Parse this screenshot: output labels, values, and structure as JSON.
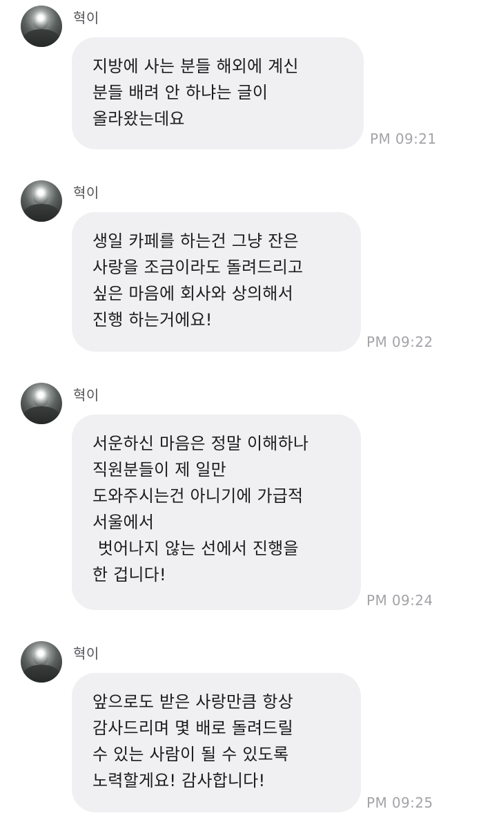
{
  "messages": [
    {
      "sender": "혁이",
      "text": "지방에 사는 분들 해외에 계신\n분들 배려 안 하냐는 글이\n올라왔는데요",
      "time": "PM 09:21"
    },
    {
      "sender": "혁이",
      "text": "생일 카페를 하는건 그냥 잔은\n사랑을 조금이라도 돌려드리고\n싶은 마음에 회사와 상의해서\n진행 하는거에요!",
      "time": "PM 09:22"
    },
    {
      "sender": "혁이",
      "text": "서운하신 마음은 정말 이해하나\n직원분들이 제 일만\n도와주시는건 아니기에 가급적\n서울에서\n 벗어나지 않는 선에서 진행을\n한 겁니다!",
      "time": "PM 09:24"
    },
    {
      "sender": "혁이",
      "text": "앞으로도 받은 사랑만큼 항상\n감사드리며 몇 배로 돌려드릴\n수 있는 사람이 될 수 있도록\n노력할게요! 감사합니다!",
      "time": "PM 09:25"
    }
  ]
}
